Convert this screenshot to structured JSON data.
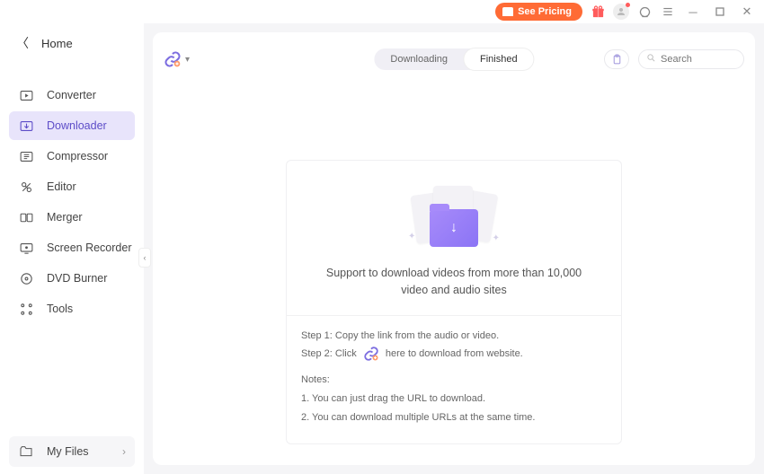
{
  "titlebar": {
    "pricing_label": "See Pricing"
  },
  "sidebar": {
    "home_label": "Home",
    "items": [
      {
        "label": "Converter"
      },
      {
        "label": "Downloader"
      },
      {
        "label": "Compressor"
      },
      {
        "label": "Editor"
      },
      {
        "label": "Merger"
      },
      {
        "label": "Screen Recorder"
      },
      {
        "label": "DVD Burner"
      },
      {
        "label": "Tools"
      }
    ],
    "my_files_label": "My Files"
  },
  "topbar": {
    "tabs": {
      "downloading": "Downloading",
      "finished": "Finished"
    },
    "search_placeholder": "Search"
  },
  "empty": {
    "support_text": "Support to download videos from more than 10,000 video and audio sites",
    "step1": "Step 1: Copy the link from the audio or video.",
    "step2a": "Step 2: Click",
    "step2b": "here to download from website.",
    "notes_label": "Notes:",
    "note1": "1. You can just drag the URL to download.",
    "note2": "2. You can download multiple URLs at the same time."
  }
}
